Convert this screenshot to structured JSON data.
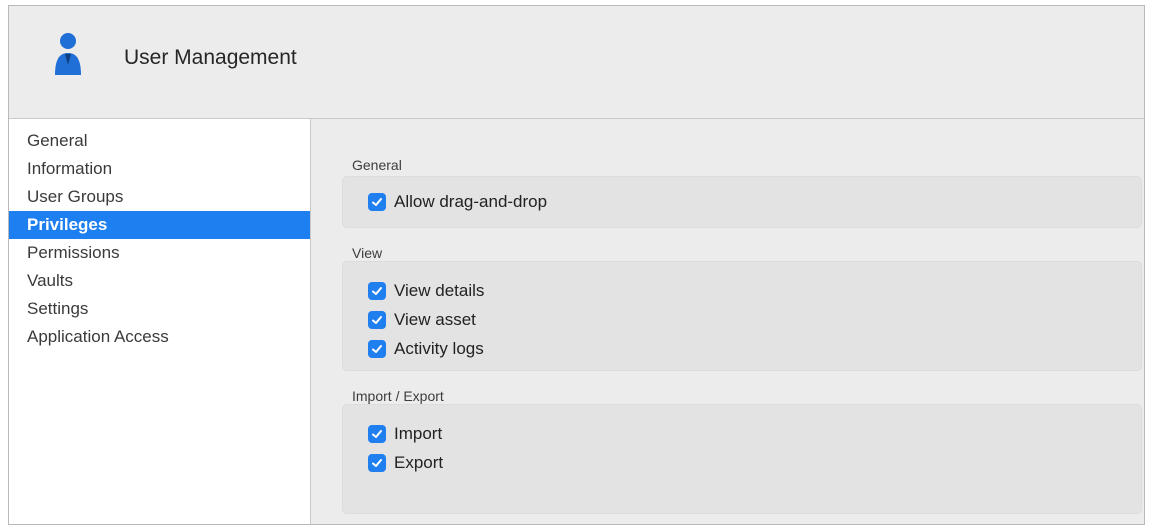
{
  "window": {
    "title": "User Management",
    "icon": "user-icon"
  },
  "sidebar": {
    "items": [
      {
        "label": "General",
        "selected": false
      },
      {
        "label": "Information",
        "selected": false
      },
      {
        "label": "User Groups",
        "selected": false
      },
      {
        "label": "Privileges",
        "selected": true
      },
      {
        "label": "Permissions",
        "selected": false
      },
      {
        "label": "Vaults",
        "selected": false
      },
      {
        "label": "Settings",
        "selected": false
      },
      {
        "label": "Application Access",
        "selected": false
      }
    ]
  },
  "sections": [
    {
      "title": "General",
      "options": [
        {
          "label": "Allow drag-and-drop",
          "checked": true
        }
      ]
    },
    {
      "title": "View",
      "options": [
        {
          "label": "View details",
          "checked": true
        },
        {
          "label": "View asset",
          "checked": true
        },
        {
          "label": "Activity logs",
          "checked": true
        }
      ]
    },
    {
      "title": "Import / Export",
      "options": [
        {
          "label": "Import",
          "checked": true
        },
        {
          "label": "Export",
          "checked": true
        }
      ]
    }
  ],
  "colors": {
    "accent": "#1e7ff0",
    "window_bg": "#ececec",
    "group_bg": "#e3e3e3"
  }
}
